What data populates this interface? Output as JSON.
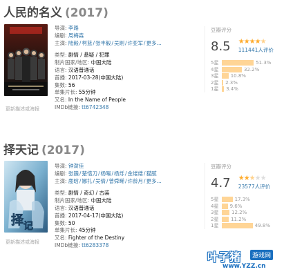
{
  "entries": [
    {
      "title": "人民的名义",
      "year": "(2017)",
      "poster_update": "更新描述或海报",
      "info": {
        "director_k": "导演:",
        "director": "李路",
        "writer_k": "编剧:",
        "writer": "周梅森",
        "cast_k": "主演:",
        "cast": [
          "陆毅",
          "柯蓝",
          "张丰毅",
          "吴刚",
          "许亚军"
        ],
        "cast_more": "更多...",
        "genre_k": "类型:",
        "genre": "剧情 / 悬疑 / 犯罪",
        "country_k": "制片国家/地区:",
        "country": "中国大陆",
        "lang_k": "语言:",
        "lang": "汉语普通话",
        "date_k": "首播:",
        "date": "2017-03-28(中国大陆)",
        "episodes_k": "集数:",
        "episodes": "56",
        "runtime_k": "单集片长:",
        "runtime": "55分钟",
        "aka_k": "又名:",
        "aka": "In the Name of People",
        "imdb_k": "IMDb链接:",
        "imdb": "tt6742348"
      },
      "rating": {
        "title": "豆瓣评分",
        "score": "8.5",
        "stars": 4.5,
        "votes": "111441人评价",
        "dist": [
          {
            "label": "5星",
            "pct": "51.3%",
            "value": 51.3
          },
          {
            "label": "4星",
            "pct": "32.2%",
            "value": 32.2
          },
          {
            "label": "3星",
            "pct": "10.8%",
            "value": 10.8
          },
          {
            "label": "2星",
            "pct": "2.3%",
            "value": 2.3
          },
          {
            "label": "1星",
            "pct": "3.4%",
            "value": 3.4
          }
        ]
      }
    },
    {
      "title": "择天记",
      "year": "(2017)",
      "poster_update": "更新描述或海报",
      "info": {
        "director_k": "导演:",
        "director": "钟澍佳",
        "writer_k": "编剧:",
        "writer": [
          "张巍",
          "楚惜刀",
          "杨暘",
          "杨烁",
          "金缕缕",
          "猫腻"
        ],
        "cast_k": "主演:",
        "cast": [
          "鹿晗",
          "娜扎",
          "吴倩",
          "曾舜晞",
          "许龄月"
        ],
        "cast_more": "更多...",
        "genre_k": "类型:",
        "genre": "剧情 / 奇幻 / 古装",
        "country_k": "制片国家/地区:",
        "country": "中国大陆",
        "lang_k": "语言:",
        "lang": "汉语普通话",
        "date_k": "首播:",
        "date": "2017-04-17(中国大陆)",
        "episodes_k": "集数:",
        "episodes": "50",
        "runtime_k": "单集片长:",
        "runtime": "45分钟",
        "aka_k": "又名:",
        "aka": "Fighter of the Destiny",
        "imdb_k": "IMDb链接:",
        "imdb": "tt6283378"
      },
      "rating": {
        "title": "豆瓣评分",
        "score": "4.7",
        "stars": 2.5,
        "votes": "23577人评价",
        "dist": [
          {
            "label": "5星",
            "pct": "17.3%",
            "value": 17.3
          },
          {
            "label": "4星",
            "pct": "9.6%",
            "value": 9.6
          },
          {
            "label": "3星",
            "pct": "12.2%",
            "value": 12.2
          },
          {
            "label": "2星",
            "pct": "11.2%",
            "value": 11.2
          },
          {
            "label": "1星",
            "pct": "49.8%",
            "value": 49.8
          }
        ]
      }
    }
  ],
  "watermark": {
    "brand": "叶子猪",
    "sub": "游戏网",
    "url": "www.YZZ.cn"
  },
  "colors": {
    "link": "#3377aa",
    "star": "#ffac2d",
    "bar": "#ffd596",
    "watermark": "#1a6fbf"
  }
}
